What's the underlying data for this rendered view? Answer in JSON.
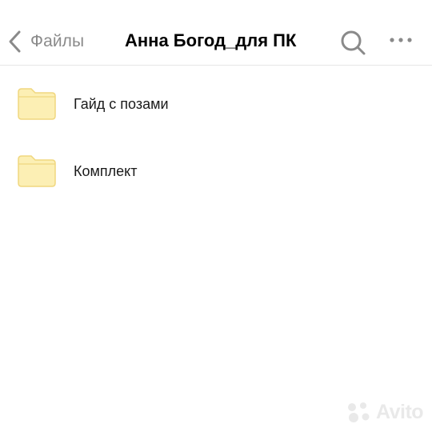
{
  "header": {
    "back_label": "Файлы",
    "title": "Анна Богод_для ПК",
    "icons": {
      "back": "chevron-left-icon",
      "search": "search-icon",
      "more": "more-horizontal-icon"
    }
  },
  "files": [
    {
      "name": "Гайд с позами",
      "type": "folder"
    },
    {
      "name": "Комплект",
      "type": "folder"
    }
  ],
  "watermark": {
    "text": "Avito"
  },
  "colors": {
    "background": "#ffffff",
    "folder_fill": "#fcefb4",
    "folder_stroke": "#f0d77f",
    "icon_gray": "#8a8a8a",
    "title": "#000000"
  }
}
